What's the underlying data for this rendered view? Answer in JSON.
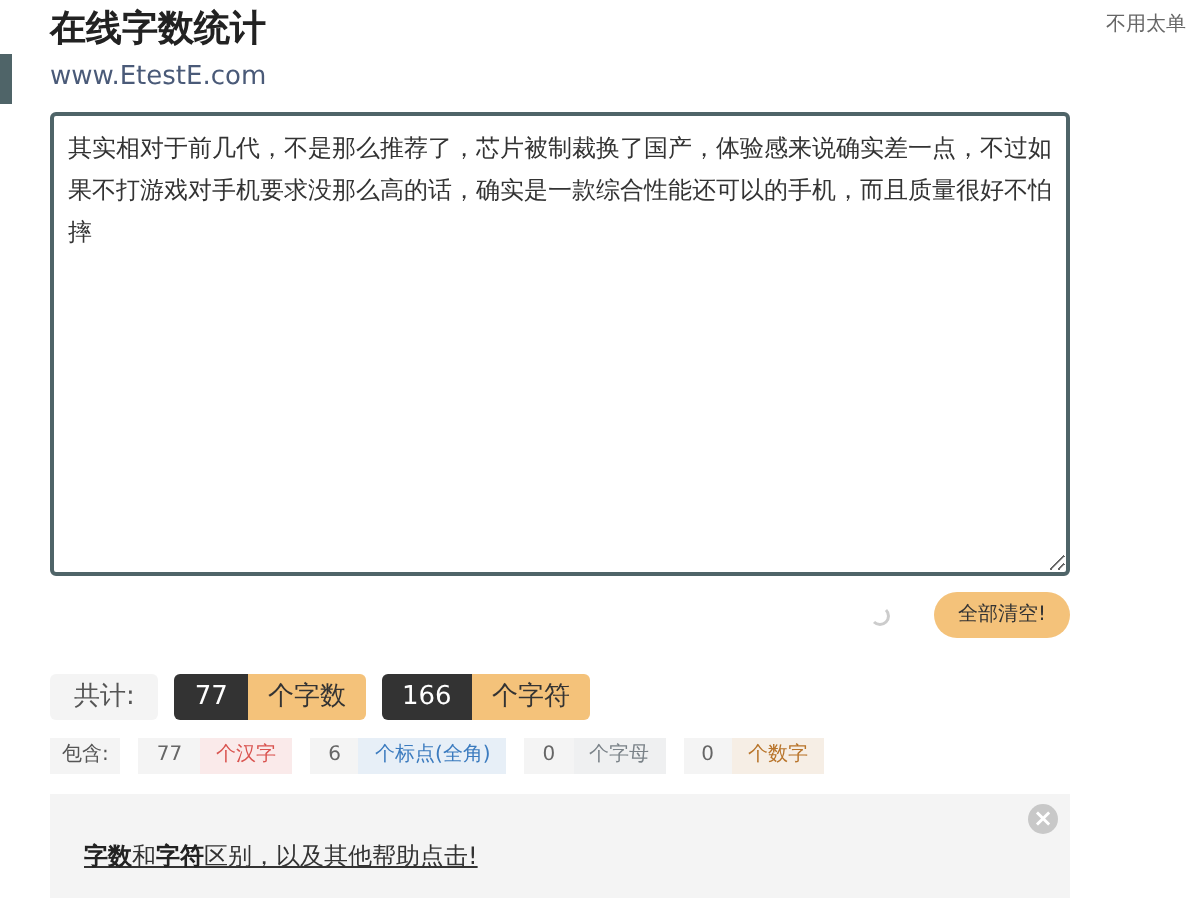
{
  "header": {
    "title": "在线字数统计",
    "site": "www.EtestE.com",
    "side_note": "不用太单"
  },
  "editor": {
    "value": "其实相对于前几代，不是那么推荐了，芯片被制裁换了国产，体验感来说确实差一点，不过如果不打游戏对手机要求没那么高的话，确实是一款综合性能还可以的手机，而且质量很好不怕摔"
  },
  "clear_button": "全部清空!",
  "totals": {
    "label": "共计:",
    "items": [
      {
        "count": "77",
        "unit": "个字数"
      },
      {
        "count": "166",
        "unit": "个字符"
      }
    ]
  },
  "breakdown": {
    "label": "包含:",
    "items": [
      {
        "count": "77",
        "unit": "个汉字",
        "color": "#d9534f"
      },
      {
        "count": "6",
        "unit": "个标点(全角)",
        "color": "#3b7bbf"
      },
      {
        "count": "0",
        "unit": "个字母",
        "color": "#7a8288"
      },
      {
        "count": "0",
        "unit": "个数字",
        "color": "#b8742a"
      }
    ]
  },
  "help": {
    "link": "**字数**和**字符**区别，以及其他帮助点击!",
    "close": "×"
  }
}
